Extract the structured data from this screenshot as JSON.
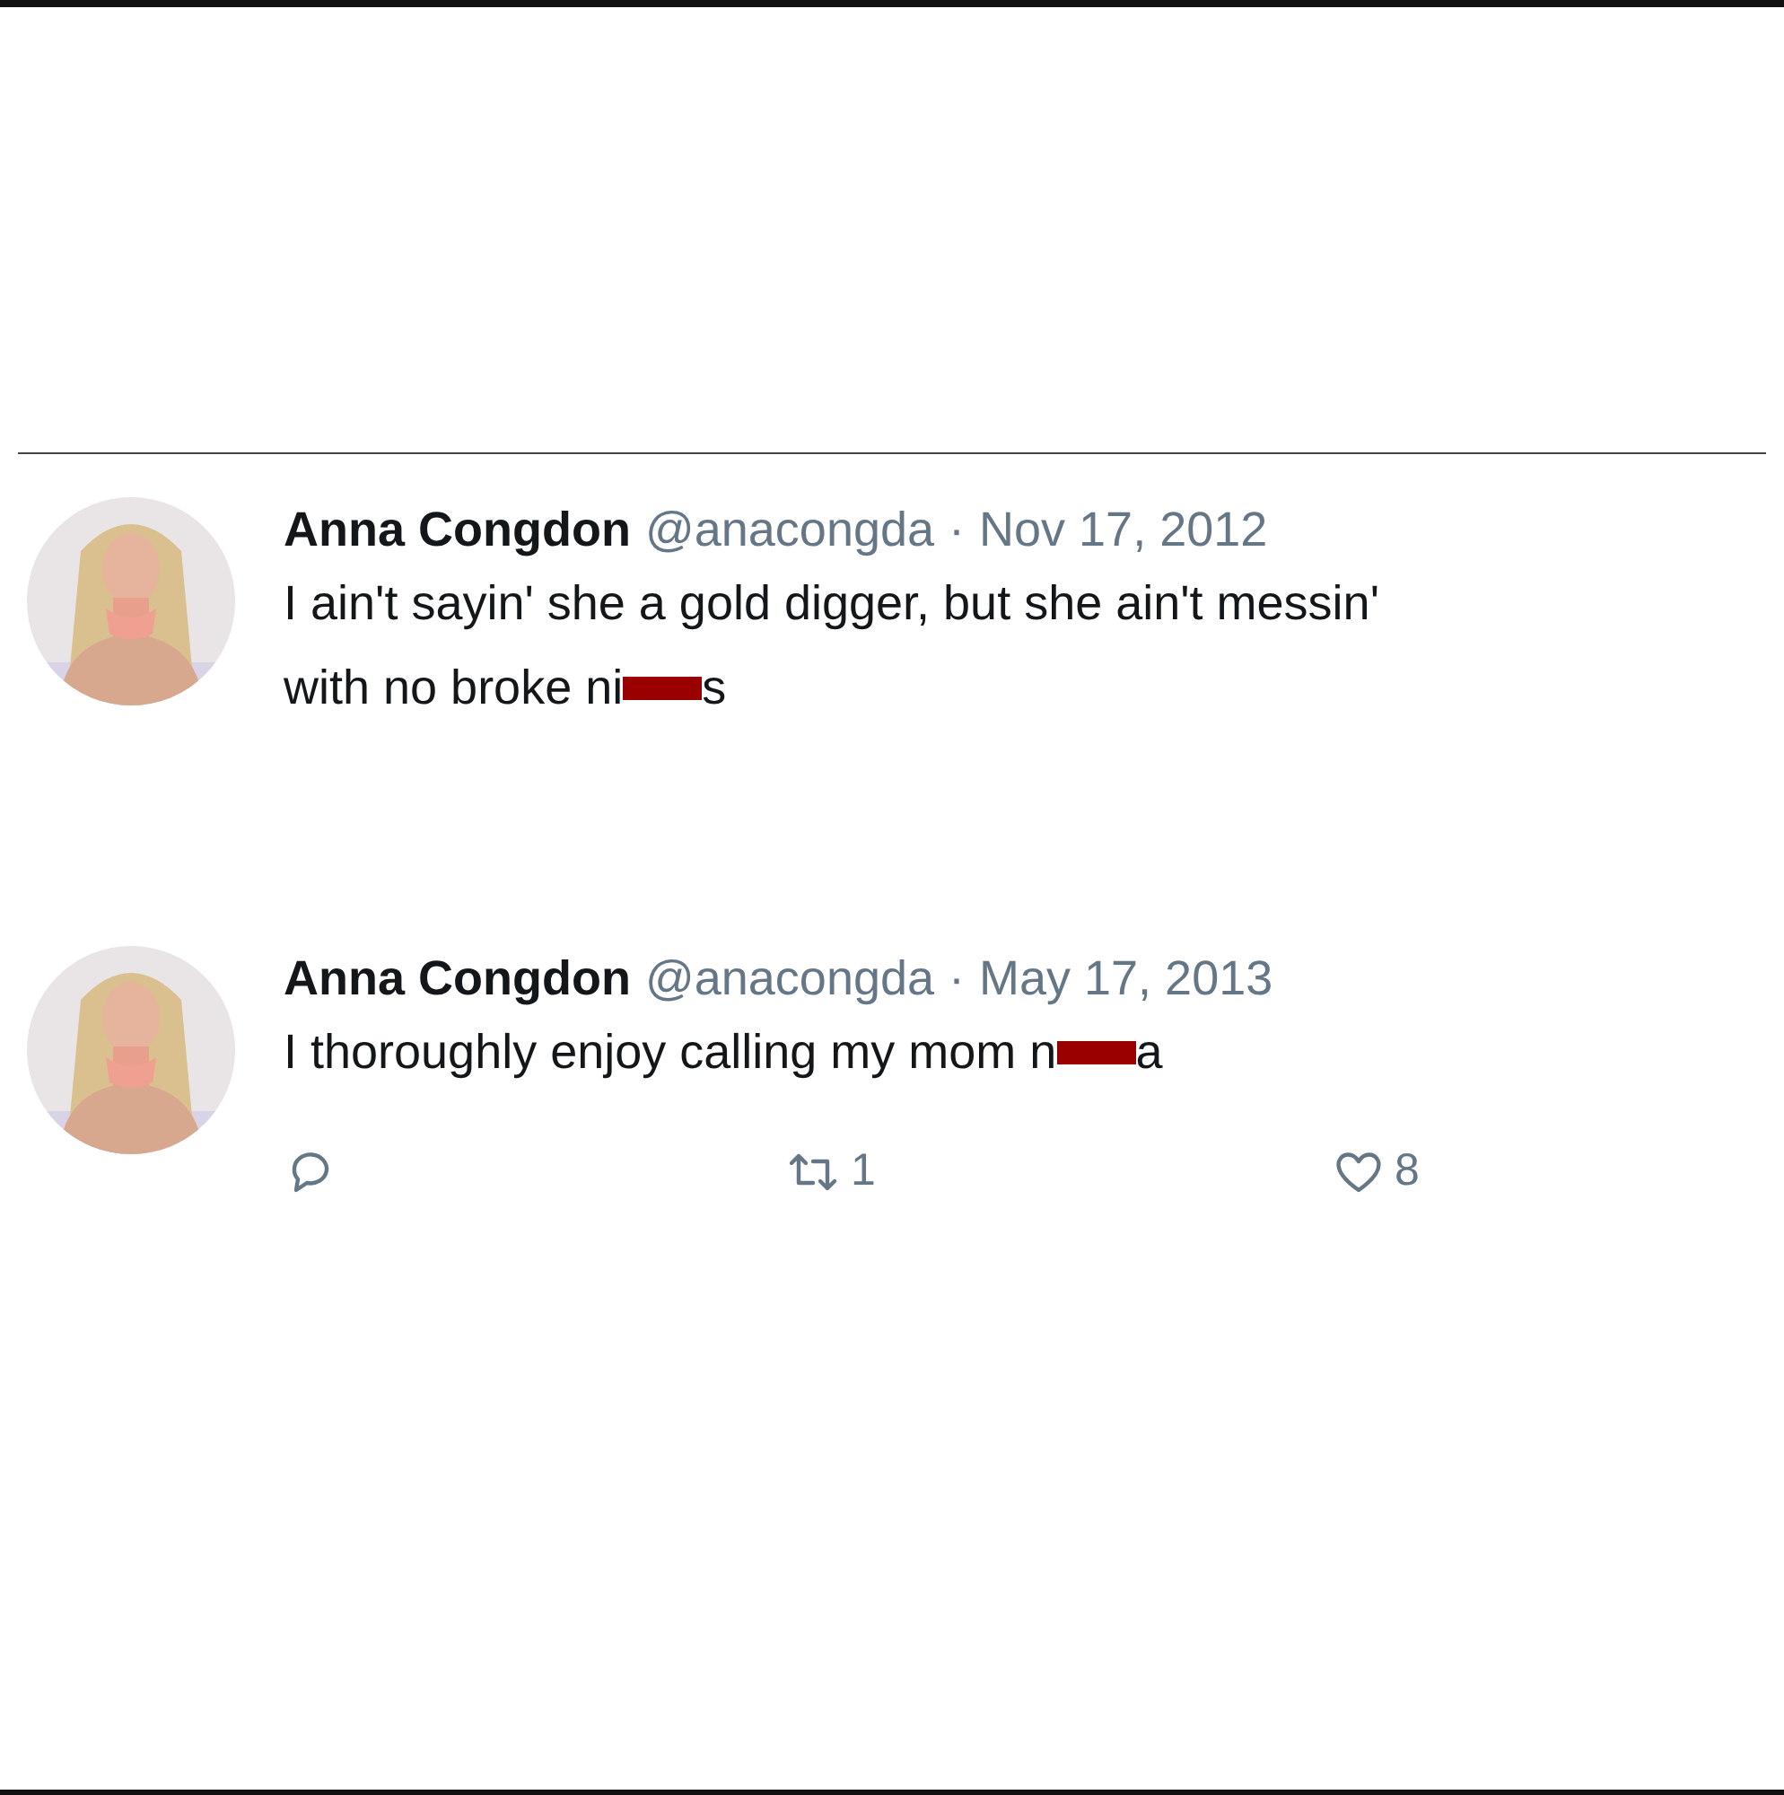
{
  "tweets": [
    {
      "name": "Anna Congdon",
      "handle": "@anacongda",
      "separator": "·",
      "date": "Nov 17, 2012",
      "avatar": {
        "kind": "picture"
      },
      "lines": [
        [
          {
            "kind": "text",
            "text": "I ain't sayin' she a gold digger, but she ain't messin'"
          }
        ],
        [
          {
            "kind": "text",
            "text": "with no broke ni"
          },
          {
            "kind": "redaction"
          },
          {
            "kind": "text",
            "text": "s"
          }
        ]
      ]
    },
    {
      "name": "Anna Congdon",
      "handle": "@anacongda",
      "separator": "·",
      "date": "May 17, 2013",
      "avatar": {
        "kind": "picture"
      },
      "lines": [
        [
          {
            "kind": "text",
            "text": "I thoroughly enjoy calling my mom n"
          },
          {
            "kind": "redaction"
          },
          {
            "kind": "text",
            "text": "a"
          }
        ]
      ],
      "actions": [
        {
          "kind": "reply"
        },
        {
          "kind": "retweet",
          "count": "1"
        },
        {
          "kind": "like",
          "count": "8"
        }
      ]
    }
  ]
}
